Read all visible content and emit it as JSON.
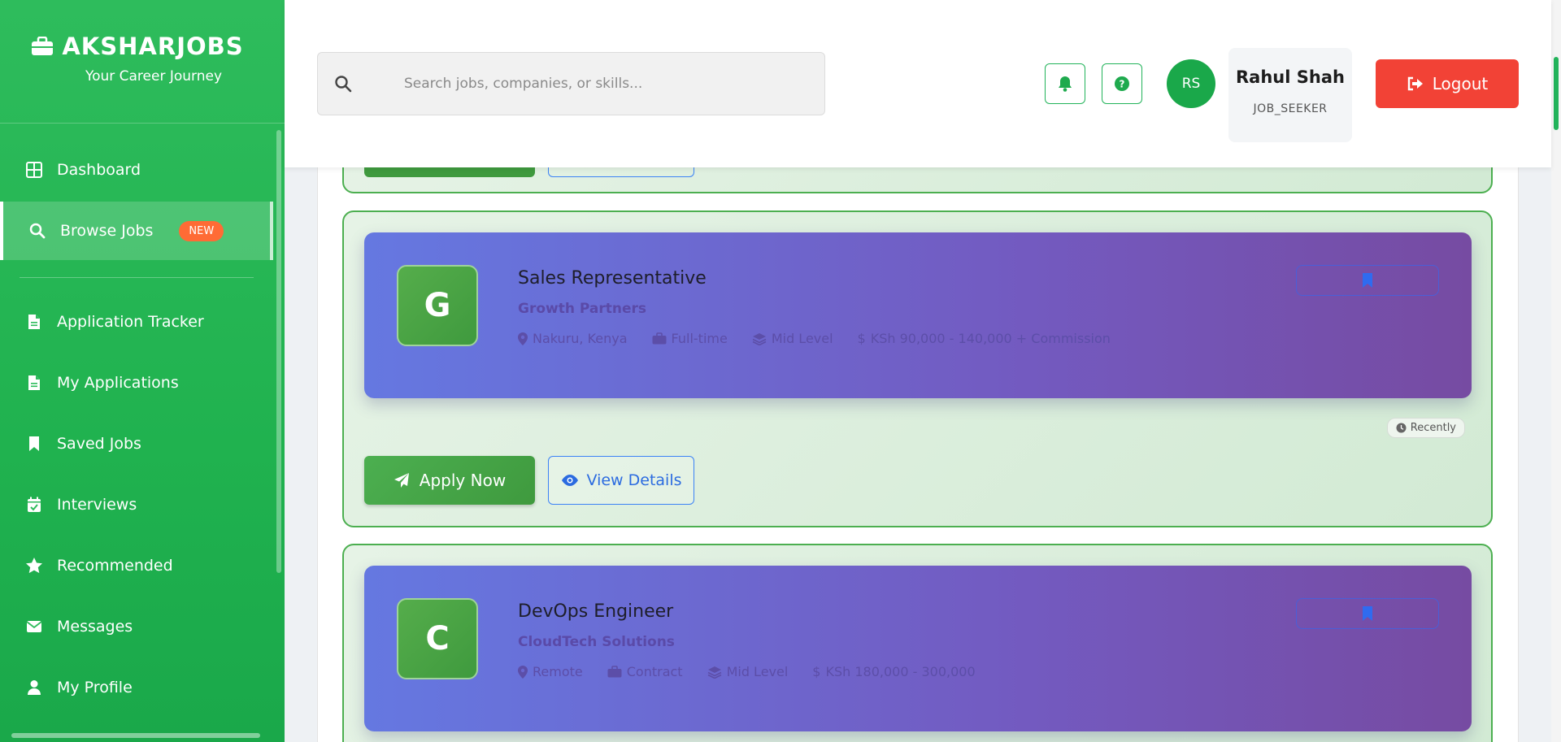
{
  "brand": {
    "title": "AKSHARJOBS",
    "subtitle": "Your Career Journey"
  },
  "sidebar": {
    "items": [
      {
        "label": "Dashboard",
        "icon": "grid-icon"
      },
      {
        "label": "Browse Jobs",
        "icon": "search-icon",
        "badge": "NEW",
        "active": true
      },
      {
        "label": "Application Tracker",
        "icon": "document-icon"
      },
      {
        "label": "My Applications",
        "icon": "document-icon"
      },
      {
        "label": "Saved Jobs",
        "icon": "bookmark-icon"
      },
      {
        "label": "Interviews",
        "icon": "calendar-check-icon"
      },
      {
        "label": "Recommended",
        "icon": "star-icon"
      },
      {
        "label": "Messages",
        "icon": "envelope-icon"
      },
      {
        "label": "My Profile",
        "icon": "user-icon"
      }
    ]
  },
  "header": {
    "search_placeholder": "Search jobs, companies, or skills...",
    "avatar_initials": "RS",
    "user_name": "Rahul Shah",
    "user_role": "JOB_SEEKER",
    "logout_label": "Logout"
  },
  "jobs": [
    {
      "logo_letter": "G",
      "title": "Sales Representative",
      "company": "Growth Partners",
      "location": "Nakuru, Kenya",
      "type": "Full-time",
      "level": "Mid Level",
      "salary": "KSh 90,000 - 140,000 + Commission",
      "posted": "Recently",
      "apply_label": "Apply Now",
      "details_label": "View Details"
    },
    {
      "logo_letter": "C",
      "title": "DevOps Engineer",
      "company": "CloudTech Solutions",
      "location": "Remote",
      "type": "Contract",
      "level": "Mid Level",
      "salary": "KSh 180,000 - 300,000"
    }
  ],
  "colors": {
    "sidebar_green": "#20b24f",
    "accent_green": "#4caf50",
    "logout_red": "#f24236",
    "badge_orange": "#ff6b35",
    "job_header_start": "#6578e1",
    "job_header_end": "#764ba2"
  }
}
